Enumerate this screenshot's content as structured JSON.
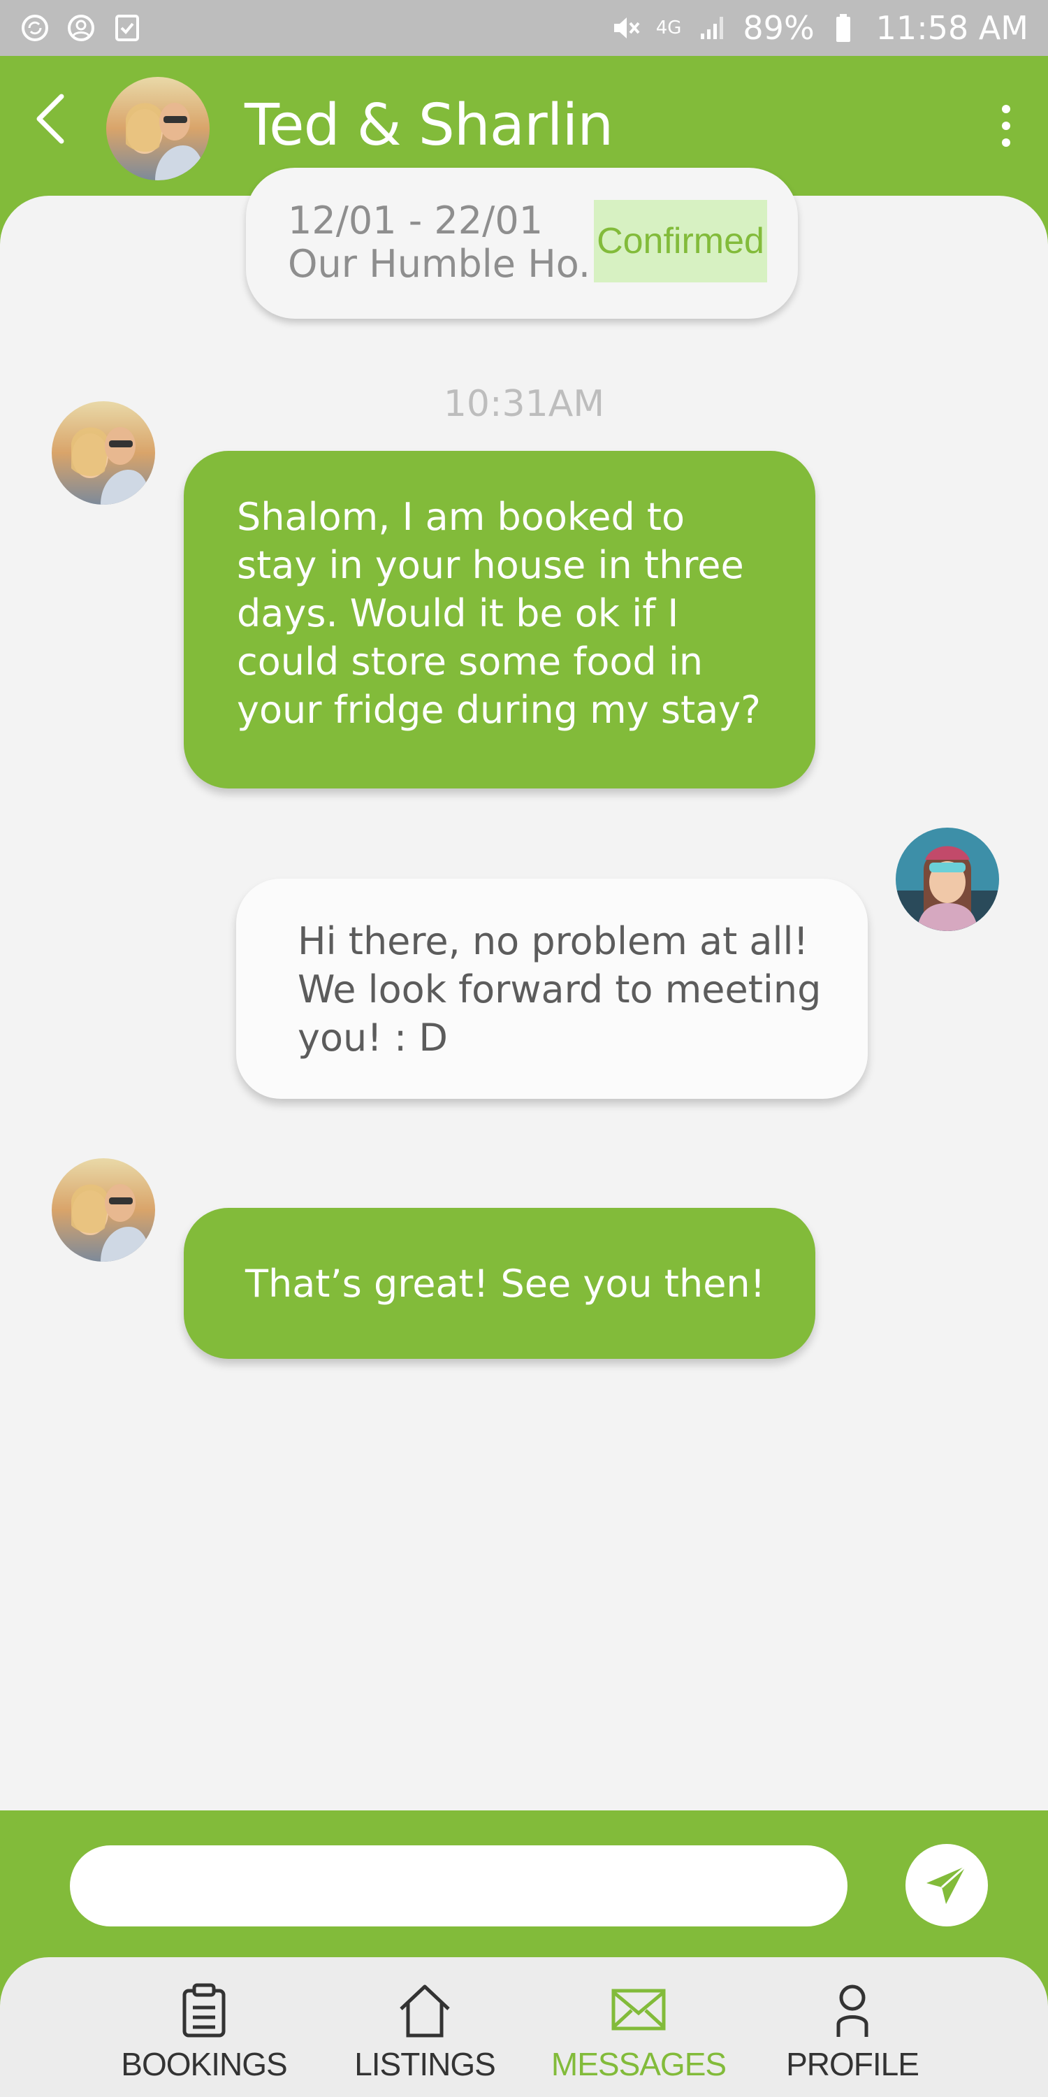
{
  "status_bar": {
    "battery": "89%",
    "time": "11:58 AM",
    "network": "4G",
    "icons": [
      "sync-icon",
      "account-circle-icon",
      "checkbox-icon",
      "mute-icon",
      "signal-icon",
      "battery-icon"
    ]
  },
  "header": {
    "title": "Ted & Sharlin",
    "back_icon": "chevron-left-icon",
    "menu_icon": "more-vertical-icon"
  },
  "booking": {
    "dates": "12/01 - 22/01",
    "listing_name": "Our Humble Ho..",
    "status": "Confirmed"
  },
  "chat": {
    "time_label": "10:31AM",
    "messages": [
      {
        "direction": "sent",
        "text": "Shalom, I am booked to stay in your house in three days. Would it be ok if I could store some food in your fridge during my stay?"
      },
      {
        "direction": "received",
        "text": "Hi there, no problem at all! We look forward to meeting you! : D"
      },
      {
        "direction": "sent",
        "text": "That’s great! See you then!"
      }
    ]
  },
  "input": {
    "placeholder": "",
    "value": "",
    "send_icon": "send-icon"
  },
  "nav": {
    "items": [
      {
        "label": "BOOKINGS",
        "icon": "clipboard-icon",
        "active": false
      },
      {
        "label": "LISTINGS",
        "icon": "home-icon",
        "active": false
      },
      {
        "label": "MESSAGES",
        "icon": "mail-icon",
        "active": true
      },
      {
        "label": "PROFILE",
        "icon": "user-icon",
        "active": false
      }
    ]
  },
  "colors": {
    "accent": "#82bb3a",
    "confirmed_bg": "#d7f1c2",
    "chat_bg": "#f3f3f3",
    "nav_bg": "#ececec"
  }
}
